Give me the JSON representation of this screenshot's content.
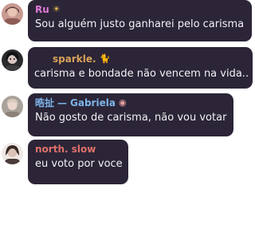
{
  "messages": [
    {
      "author": "Ru",
      "author_color": "#e07ad6",
      "badge_icon": "sun-icon",
      "badge_glyph": "☀",
      "text": "Sou alguém justo ganharei pelo carisma"
    },
    {
      "author": "sparkle.",
      "author_color": "#d9a25a",
      "badge_icon": "cat-icon",
      "badge_glyph": "🐈",
      "text": "carisma e bondade não vencem na vida.."
    },
    {
      "author_prefix": "晧扯",
      "separator": "—",
      "author": "Gabriela",
      "author_color": "#7eb4ea",
      "badge_icon": "eye-icon",
      "badge_glyph": "◉",
      "text": "Não gosto de carisma, não vou votar"
    },
    {
      "author": "north. slow",
      "author_color": "#e0716a",
      "text": "eu voto por voce"
    }
  ],
  "colors": {
    "bubble": "#2b2537",
    "text": "#f3f1f6",
    "background": "#ffffff"
  }
}
